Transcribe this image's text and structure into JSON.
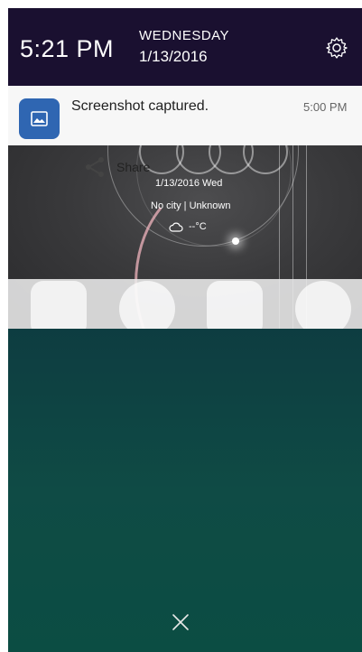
{
  "status": {
    "time": "5:21 PM",
    "day": "WEDNESDAY",
    "date": "1/13/2016"
  },
  "notification": {
    "title": "Screenshot captured.",
    "time": "5:00 PM",
    "app_icon": "image-icon"
  },
  "preview": {
    "date_line": "1/13/2016  Wed",
    "city_line": "No city  |  Unknown",
    "weather_line": "--°C"
  },
  "actions": {
    "share_label": "Share"
  },
  "colors": {
    "header_bg": "#1a1030",
    "app_icon_bg": "#2f66b2",
    "panel_top": "#0a2a3a",
    "panel_bottom": "#0b4d43"
  }
}
